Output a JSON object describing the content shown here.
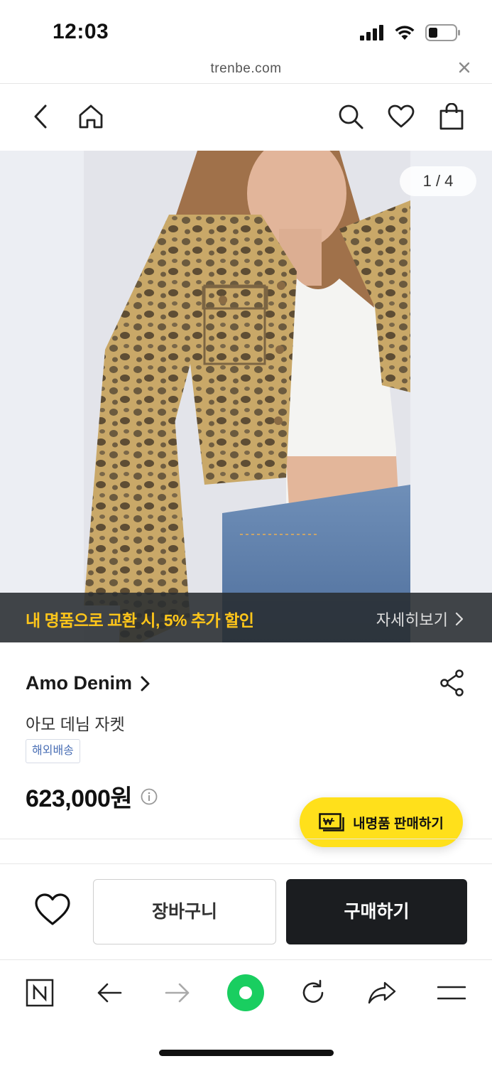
{
  "status_bar": {
    "time": "12:03"
  },
  "url_bar": {
    "domain": "trenbe.com"
  },
  "gallery": {
    "counter": "1 / 4"
  },
  "promo": {
    "text": "내 명품으로 교환 시, 5% 추가 할인",
    "more": "자세히보기"
  },
  "product": {
    "brand": "Amo Denim",
    "name": "아모 데님 자켓",
    "badge": "해외배송",
    "price": "623,000원"
  },
  "sell_button": {
    "label": "내명품 판매하기"
  },
  "actions": {
    "cart_label": "장바구니",
    "buy_label": "구매하기"
  },
  "colors": {
    "accent_yellow": "#ffe01b",
    "promo_text": "#ffc61a",
    "buy_bg": "#1b1d20",
    "naver_green": "#1ec800"
  },
  "icons": [
    "back-icon",
    "home-icon",
    "search-icon",
    "heart-icon",
    "bag-icon",
    "share-icon",
    "info-icon",
    "won-card-icon",
    "naver-n-icon",
    "forward-icon",
    "reload-icon",
    "share-arrow-icon",
    "menu-icon"
  ]
}
